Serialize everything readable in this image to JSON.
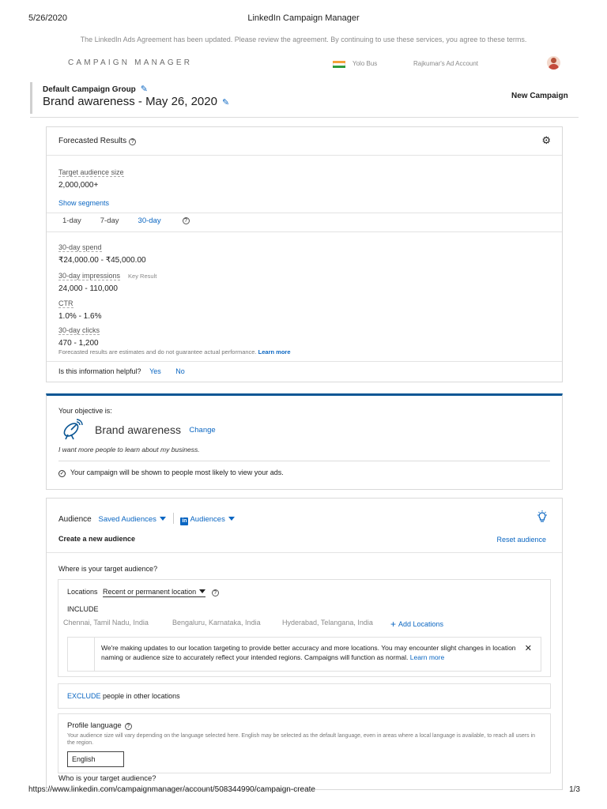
{
  "print": {
    "date": "5/26/2020",
    "title": "LinkedIn Campaign Manager",
    "url": "https://www.linkedin.com/campaignmanager/account/508344990/campaign-create",
    "page": "1/3"
  },
  "topbar": {
    "agreement_notice": "The LinkedIn Ads Agreement has been updated. Please review the agreement. By continuing to use these services, you agree to these terms.",
    "brand": "CAMPAIGN MANAGER",
    "account_name": "Yolo Bus",
    "ad_account": "Rajkumar's Ad Account"
  },
  "header": {
    "group_name": "Default Campaign Group",
    "campaign_name": "Brand awareness - May 26, 2020",
    "new_campaign_label": "New Campaign"
  },
  "forecast": {
    "title": "Forecasted Results",
    "audience_size_label": "Target audience size",
    "audience_size_value": "2,000,000+",
    "show_segments": "Show segments",
    "tabs": [
      "1-day",
      "7-day",
      "30-day"
    ],
    "active_tab": "30-day",
    "metrics": [
      {
        "label": "30-day spend",
        "value": "₹24,000.00 - ₹45,000.00",
        "tag": ""
      },
      {
        "label": "30-day impressions",
        "value": "24,000 - 110,000",
        "tag": "Key Result"
      },
      {
        "label": "CTR",
        "value": "1.0% - 1.6%",
        "tag": ""
      },
      {
        "label": "30-day clicks",
        "value": "470 - 1,200",
        "tag": ""
      }
    ],
    "disclaimer": "Forecasted results are estimates and do not guarantee actual performance.",
    "learn_more": "Learn more",
    "helpful_question": "Is this information helpful?",
    "yes": "Yes",
    "no": "No"
  },
  "objective": {
    "heading": "Your objective is:",
    "name": "Brand awareness",
    "change": "Change",
    "description": "I want more people to learn about my business.",
    "note": "Your campaign will be shown to people most likely to view your ads."
  },
  "audience": {
    "title": "Audience",
    "saved_audiences": "Saved Audiences",
    "audiences": "Audiences",
    "create_new": "Create a new audience",
    "reset": "Reset audience",
    "where_question": "Where is your target audience?",
    "locations_label": "Locations",
    "location_type": "Recent or permanent location",
    "include_label": "INCLUDE",
    "locations": [
      "Chennai, Tamil Nadu, India",
      "Bengaluru, Karnataka, India",
      "Hyderabad, Telangana, India"
    ],
    "add_locations": "Add Locations",
    "info_text": "We're making updates to our location targeting to provide better accuracy and more locations. You may encounter slight changes in location naming or audience size to accurately reflect your intended regions. Campaigns will function as normal.",
    "info_learn_more": "Learn more",
    "exclude_link": "EXCLUDE",
    "exclude_text": "people in other locations",
    "profile_language_label": "Profile language",
    "profile_language_note": "Your audience size will vary depending on the language selected here. English may be selected as the default language, even in areas where a local language is available, to reach all users in the region.",
    "language_value": "English",
    "who_question": "Who is your target audience?"
  },
  "colors": {
    "accent": "#0a66c2",
    "objective_bar": "#0a5694"
  }
}
